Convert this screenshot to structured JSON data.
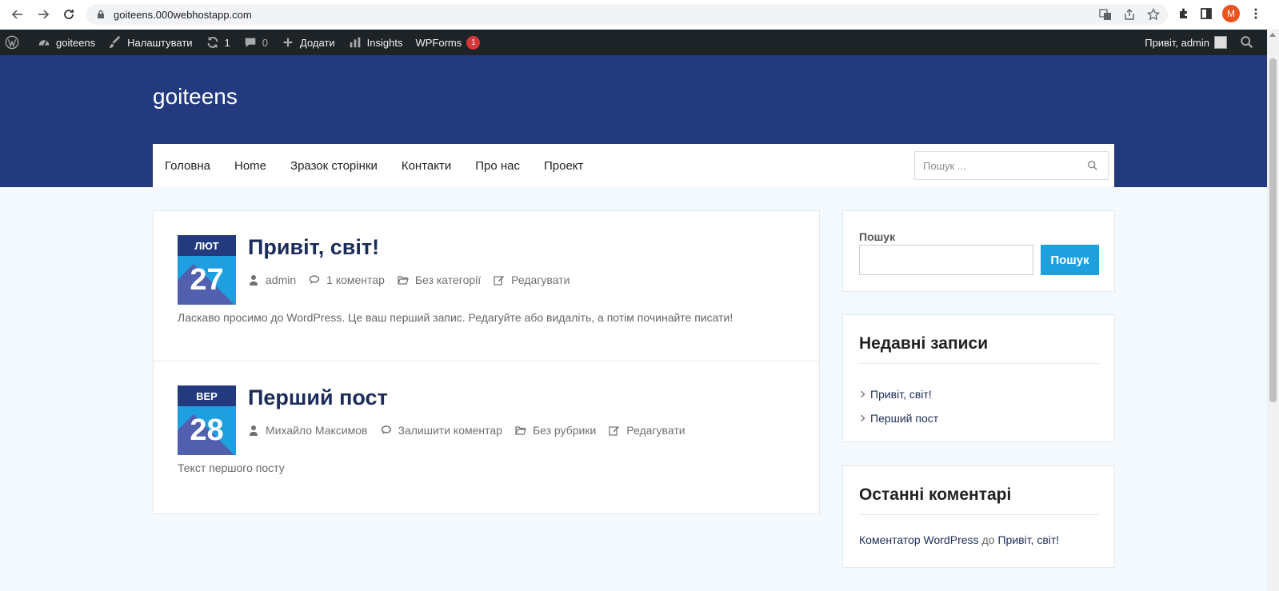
{
  "browser": {
    "url": "goiteens.000webhostapp.com",
    "profile_initial": "M"
  },
  "adminbar": {
    "site_name": "goiteens",
    "customize": "Налаштувати",
    "updates_count": "1",
    "comments_count": "0",
    "add_new": "Додати",
    "insights": "Insights",
    "wpforms": "WPForms",
    "wpforms_badge": "1",
    "greeting": "Привіт, admin"
  },
  "header": {
    "site_title": "goiteens",
    "menu": [
      "Головна",
      "Home",
      "Зразок сторінки",
      "Контакти",
      "Про нас",
      "Проект"
    ],
    "search_placeholder": "Пошук ..."
  },
  "posts": [
    {
      "month": "ЛЮТ",
      "day": "27",
      "title": "Привіт, світ!",
      "author": "admin",
      "comments": "1 коментар",
      "category": "Без категорії",
      "edit": "Редагувати",
      "excerpt": "Ласкаво просимо до WordPress. Це ваш перший запис. Редагуйте або видаліть, а потім починайте писати!"
    },
    {
      "month": "ВЕР",
      "day": "28",
      "title": "Перший пост",
      "author": "Михайло Максимов",
      "comments": "Залишити коментар",
      "category": "Без рубрики",
      "edit": "Редагувати",
      "excerpt": "Текст першого посту"
    }
  ],
  "sidebar": {
    "search_label": "Пошук",
    "search_button": "Пошук",
    "recent_title": "Недавні записи",
    "recent_items": [
      "Привіт, світ!",
      "Перший пост"
    ],
    "comments_title": "Останні коментарі",
    "comment_author": "Коментатор WordPress",
    "comment_on": "до",
    "comment_post": "Привіт, світ!"
  },
  "colors": {
    "header_bg": "#233a7e",
    "accent": "#1e9fe0",
    "adminbar_bg": "#1d2327",
    "badge": "#d63638"
  }
}
